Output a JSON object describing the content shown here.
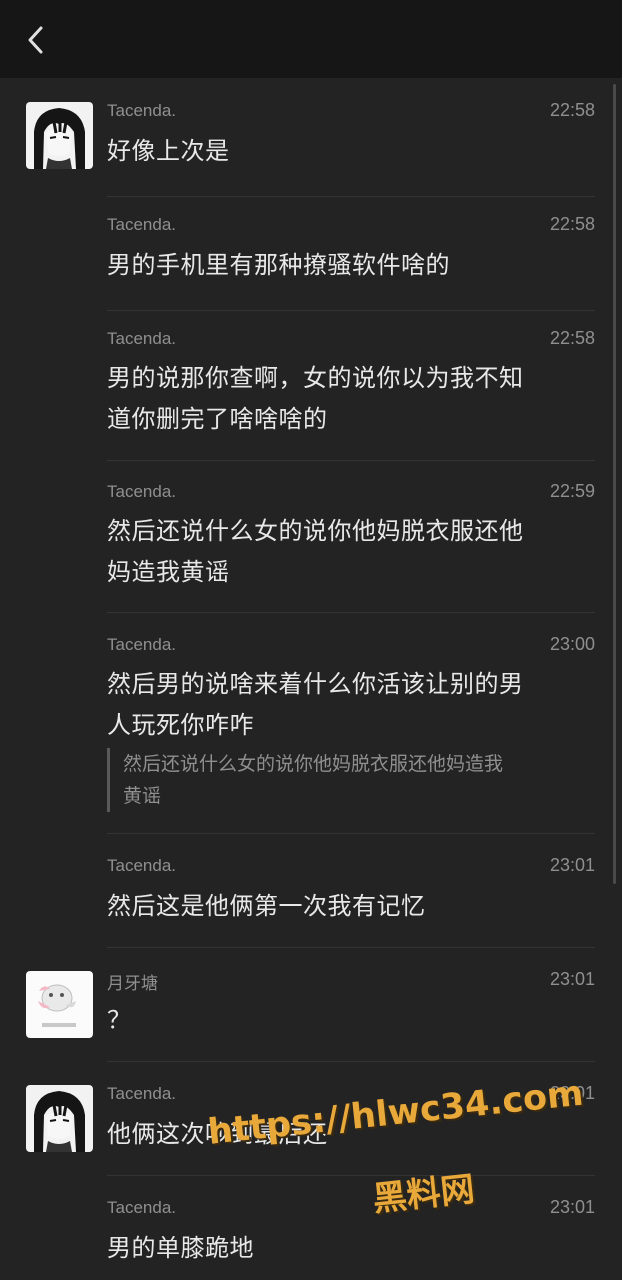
{
  "header": {
    "back_icon": "chevron-left-icon"
  },
  "colors": {
    "background": "#232323",
    "header": "#161616",
    "text": "#e8e8e8",
    "meta": "#8f8f8f",
    "watermark": "#e8a83a"
  },
  "messages": [
    {
      "sender": "Tacenda.",
      "time": "22:58",
      "text": "好像上次是",
      "avatar": "tacenda-avatar"
    },
    {
      "sender": "Tacenda.",
      "time": "22:58",
      "text": "男的手机里有那种撩骚软件啥的"
    },
    {
      "sender": "Tacenda.",
      "time": "22:58",
      "text_line1": "男的说那你查啊，女的说你以为我不知",
      "text_line2": "道你删完了啥啥啥的"
    },
    {
      "sender": "Tacenda.",
      "time": "22:59",
      "text_line1": "然后还说什么女的说你他妈脱衣服还他",
      "text_line2": "妈造我黄谣"
    },
    {
      "sender": "Tacenda.",
      "time": "23:00",
      "text_line1": "然后男的说啥来着什么你活该让别的男",
      "text_line2": "人玩死你咋咋",
      "quote_line1": "然后还说什么女的说你他妈脱衣服还他妈造我",
      "quote_line2": "黄谣"
    },
    {
      "sender": "Tacenda.",
      "time": "23:01",
      "text": "然后这是他俩第一次我有记忆"
    },
    {
      "sender": "月牙塘",
      "time": "23:01",
      "text": "？",
      "avatar": "yueyatang-avatar"
    },
    {
      "sender": "Tacenda.",
      "time": "23:01",
      "text": "他俩这次吵到最后还",
      "avatar": "tacenda-avatar"
    },
    {
      "sender": "Tacenda.",
      "time": "23:01",
      "text": "男的单膝跪地"
    }
  ],
  "watermark": {
    "url": "https://hlwc34.com",
    "name": "黑料网"
  }
}
